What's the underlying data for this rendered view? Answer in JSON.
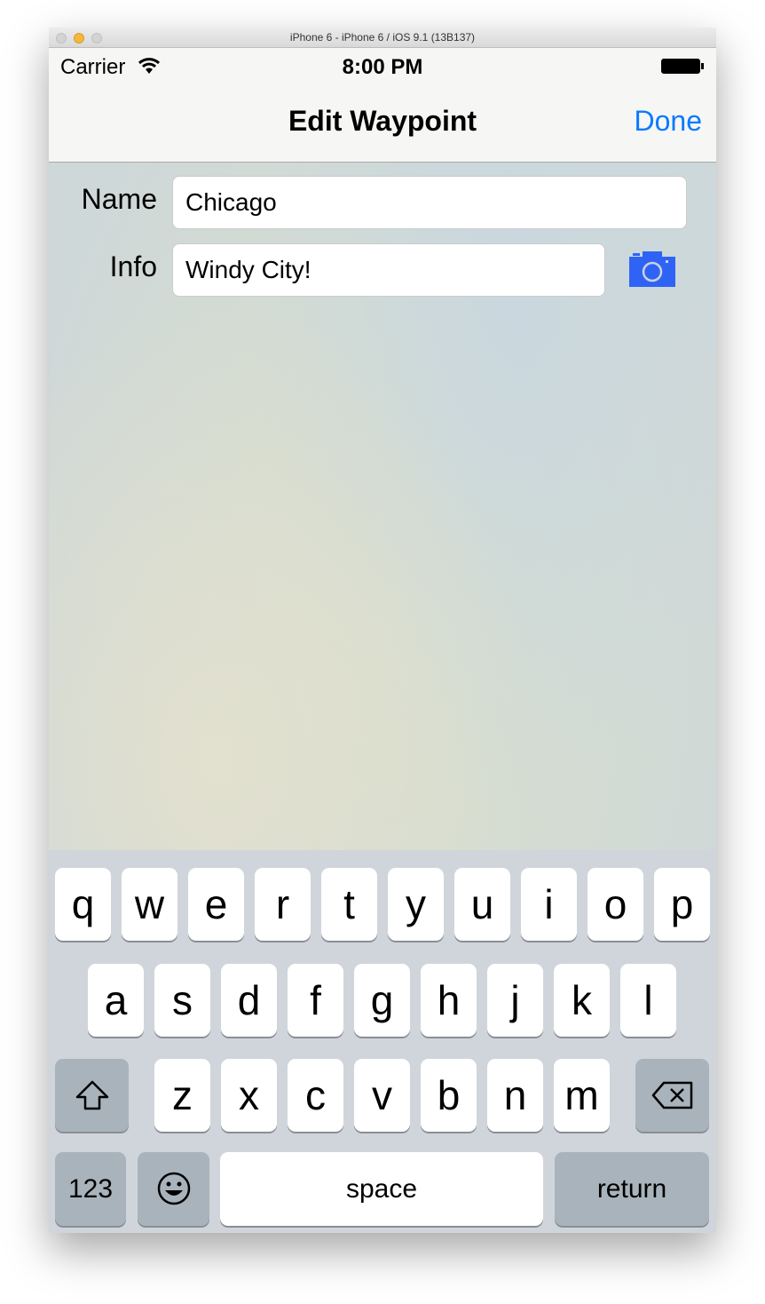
{
  "window": {
    "title": "iPhone 6 - iPhone 6 / iOS 9.1 (13B137)"
  },
  "status": {
    "carrier": "Carrier",
    "time": "8:00 PM"
  },
  "nav": {
    "title": "Edit Waypoint",
    "done": "Done"
  },
  "form": {
    "name_label": "Name",
    "name_value": "Chicago",
    "info_label": "Info",
    "info_value": "Windy City!"
  },
  "colors": {
    "accent": "#0a7aff",
    "camera": "#2f63f6"
  },
  "keyboard": {
    "row1": [
      "q",
      "w",
      "e",
      "r",
      "t",
      "y",
      "u",
      "i",
      "o",
      "p"
    ],
    "row2": [
      "a",
      "s",
      "d",
      "f",
      "g",
      "h",
      "j",
      "k",
      "l"
    ],
    "row3": [
      "z",
      "x",
      "c",
      "v",
      "b",
      "n",
      "m"
    ],
    "numbers": "123",
    "space": "space",
    "return": "return"
  }
}
